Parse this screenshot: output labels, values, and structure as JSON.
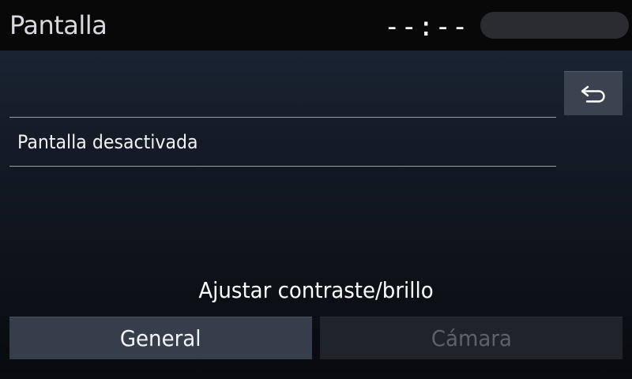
{
  "header": {
    "title": "Pantalla",
    "clock": "--:--"
  },
  "navigation": {
    "back_icon": "return-arrow-icon"
  },
  "list": {
    "items": [
      {
        "label": "Pantalla desactivada"
      }
    ]
  },
  "adjust": {
    "section_label": "Ajustar contraste/brillo",
    "buttons": [
      {
        "label": "General",
        "state": "enabled"
      },
      {
        "label": "Cámara",
        "state": "disabled"
      }
    ]
  },
  "colors": {
    "background_top": "#1d2838",
    "background_bottom": "#080a0e",
    "header_bar": "#080809",
    "button_enabled": "#363e4b",
    "button_disabled": "#1f242b",
    "text_disabled": "#5c626b"
  }
}
